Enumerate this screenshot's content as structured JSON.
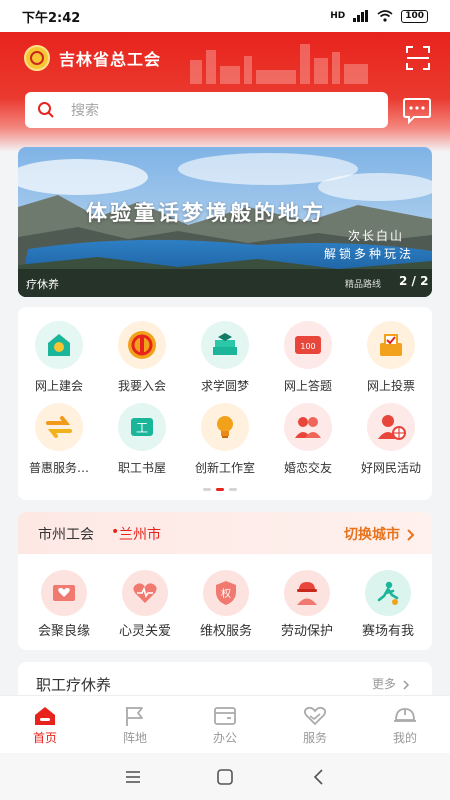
{
  "status_bar": {
    "time": "下午2:42",
    "network": "HD",
    "battery": "100"
  },
  "header": {
    "title": "吉林省总工会",
    "search_placeholder": "搜索"
  },
  "banner": {
    "headline": "体验童话梦境般的地方",
    "sub_line1": "次长白山",
    "sub_line2": "解锁多种玩法",
    "caption": "疗休养",
    "tag": "精品路线",
    "page": "2 / 2"
  },
  "features": [
    {
      "label": "网上建会",
      "icon": "home-union-icon",
      "bg": "#e4f7f3"
    },
    {
      "label": "我要入会",
      "icon": "union-emblem-icon",
      "bg": "#fff1de"
    },
    {
      "label": "求学圆梦",
      "icon": "books-icon",
      "bg": "#e3f6f1"
    },
    {
      "label": "网上答题",
      "icon": "quiz-card-icon",
      "bg": "#fde9e7"
    },
    {
      "label": "网上投票",
      "icon": "vote-box-icon",
      "bg": "#fff1de"
    },
    {
      "label": "普惠服务…",
      "icon": "exchange-icon",
      "bg": "#fff1de"
    },
    {
      "label": "职工书屋",
      "icon": "ticket-book-icon",
      "bg": "#e3f6f1"
    },
    {
      "label": "创新工作室",
      "icon": "lightbulb-icon",
      "bg": "#fff1de"
    },
    {
      "label": "婚恋交友",
      "icon": "couple-icon",
      "bg": "#fde9e7"
    },
    {
      "label": "好网民活动",
      "icon": "netizen-icon",
      "bg": "#fde9e7"
    }
  ],
  "union": {
    "title": "市州工会",
    "dot": "•",
    "city": "兰州市",
    "switch_label": "切换城市",
    "services": [
      {
        "label": "会聚良缘",
        "icon": "heart-letter-icon",
        "bg": "#fde3df"
      },
      {
        "label": "心灵关爱",
        "icon": "heartbeat-icon",
        "bg": "#fde3df"
      },
      {
        "label": "维权服务",
        "icon": "rights-shield-icon",
        "bg": "#fde3df"
      },
      {
        "label": "劳动保护",
        "icon": "worker-icon",
        "bg": "#fde3df"
      },
      {
        "label": "赛场有我",
        "icon": "athlete-icon",
        "bg": "#dcf4ee"
      }
    ]
  },
  "rest": {
    "title": "职工疗休养",
    "more": "更多"
  },
  "tabs": [
    {
      "label": "首页",
      "icon": "home-icon",
      "active": true
    },
    {
      "label": "阵地",
      "icon": "flag-icon",
      "active": false
    },
    {
      "label": "办公",
      "icon": "wallet-icon",
      "active": false
    },
    {
      "label": "服务",
      "icon": "heart-hands-icon",
      "active": false
    },
    {
      "label": "我的",
      "icon": "helmet-icon",
      "active": false
    }
  ],
  "colors": {
    "brand_red": "#e8231d",
    "accent_orange": "#e8731d"
  }
}
